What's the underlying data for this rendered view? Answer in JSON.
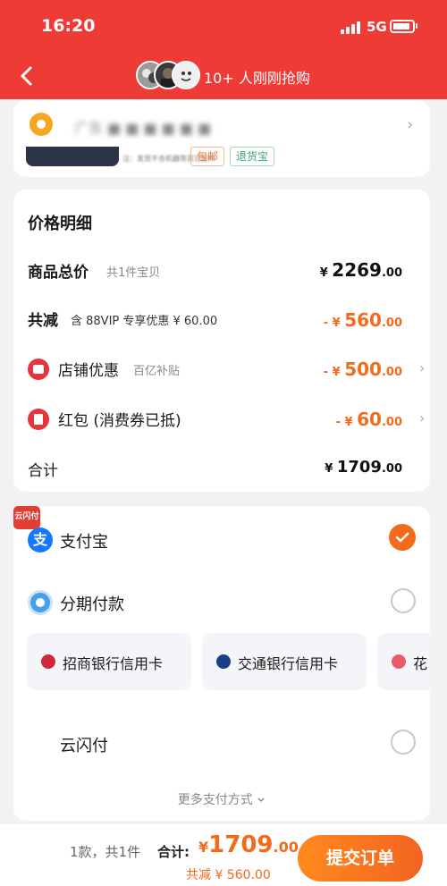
{
  "status_bar": {
    "time": "16:20",
    "network": "5G"
  },
  "header": {
    "title": "10+ 人刚刚抢购"
  },
  "address": {
    "text": "广东 ■ ■ ■ ■ ■ ■",
    "product_blurred_text": "注：发货不含机器等其它配件"
  },
  "tags": {
    "free_shipping": "包邮",
    "return_insurance": "退货宝"
  },
  "price_detail": {
    "title": "价格明细",
    "goods_total": {
      "label": "商品总价",
      "sub": "共1件宝贝",
      "currency": "¥ ",
      "integer": "2269",
      "decimal": ".00"
    },
    "total_discount": {
      "label": "共减",
      "note": "含 88VIP 专享优惠 ¥ 60.00",
      "currency": "- ¥ ",
      "integer": "560",
      "decimal": ".00"
    },
    "store_discount": {
      "label": "店铺优惠",
      "sub": "百亿补贴",
      "currency": "- ¥ ",
      "integer": "500",
      "decimal": ".00"
    },
    "red_packet": {
      "label": "红包 (消费券已抵)",
      "currency": "- ¥ ",
      "integer": "60",
      "decimal": ".00"
    },
    "subtotal": {
      "label": "合计",
      "currency": "¥ ",
      "integer": "1709",
      "decimal": ".00"
    }
  },
  "payment": {
    "alipay": "支付宝",
    "alipay_icon_char": "支",
    "installment": "分期付款",
    "banks": [
      "招商银行信用卡",
      "交通银行信用卡",
      "花"
    ],
    "unionpay": "云闪付",
    "unionpay_icon_text": "云闪付",
    "more": "更多支付方式",
    "selected": "支付宝"
  },
  "bottom": {
    "count": "1款，共1件",
    "total_label": "合计:",
    "currency": "¥",
    "integer": "1709",
    "decimal": ".00",
    "discount": "共减 ¥ 560.00",
    "submit": "提交订单"
  },
  "colors": {
    "header_red": "#ee3b36",
    "accent_orange": "#f26a1b"
  },
  "icons": [
    "back-arrow-icon",
    "location-icon",
    "chevron-right-icon",
    "store-icon",
    "red-packet-icon",
    "alipay-icon",
    "installment-icon",
    "cmb-bank-icon",
    "bocom-bank-icon",
    "huabei-icon",
    "unionpay-icon",
    "chevron-down-icon",
    "check-icon"
  ]
}
